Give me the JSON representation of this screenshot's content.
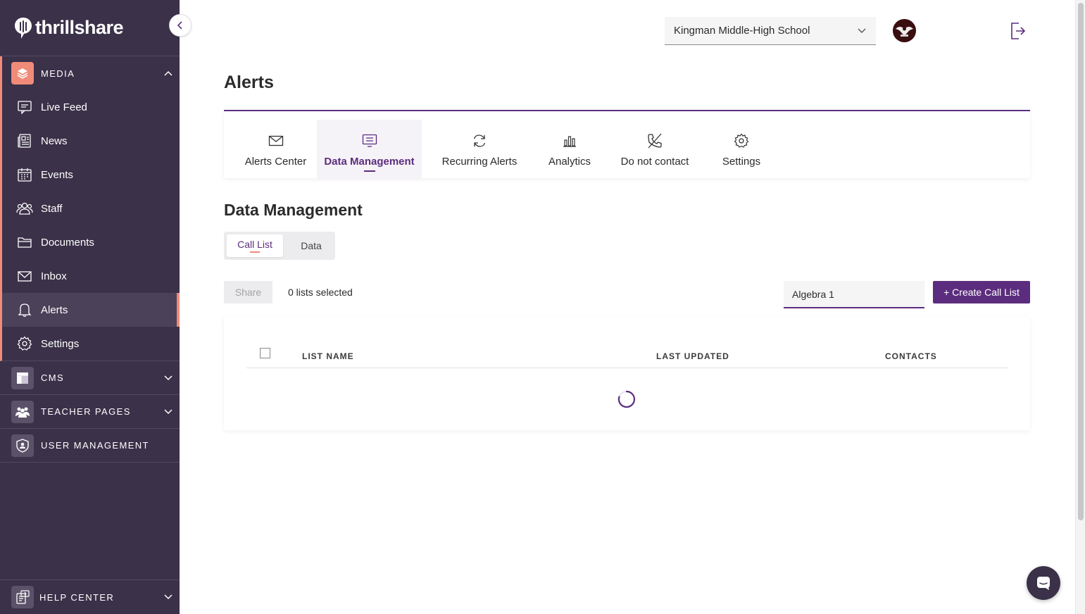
{
  "brand": {
    "name": "thrillshare"
  },
  "sidebar": {
    "media": {
      "label": "MEDIA",
      "items": [
        {
          "label": "Live Feed",
          "icon": "live-feed-icon"
        },
        {
          "label": "News",
          "icon": "news-icon"
        },
        {
          "label": "Events",
          "icon": "calendar-icon"
        },
        {
          "label": "Staff",
          "icon": "staff-icon"
        },
        {
          "label": "Documents",
          "icon": "folder-icon"
        },
        {
          "label": "Inbox",
          "icon": "mail-icon"
        },
        {
          "label": "Alerts",
          "icon": "bell-icon",
          "active": true
        },
        {
          "label": "Settings",
          "icon": "gear-icon"
        }
      ]
    },
    "cms": {
      "label": "CMS"
    },
    "teacher_pages": {
      "label": "TEACHER PAGES"
    },
    "user_management": {
      "label": "USER MANAGEMENT"
    },
    "help_center": {
      "label": "HELP CENTER"
    }
  },
  "header": {
    "school_select": {
      "value": "Kingman Middle-High School"
    }
  },
  "page": {
    "title": "Alerts"
  },
  "tabs": [
    {
      "label": "Alerts Center",
      "icon": "envelope-icon"
    },
    {
      "label": "Data Management",
      "icon": "data-icon",
      "active": true
    },
    {
      "label": "Recurring Alerts",
      "icon": "refresh-icon"
    },
    {
      "label": "Analytics",
      "icon": "bar-chart-icon"
    },
    {
      "label": "Do not contact",
      "icon": "phone-off-icon"
    },
    {
      "label": "Settings",
      "icon": "gear-icon"
    }
  ],
  "section": {
    "title": "Data Management",
    "segments": [
      {
        "label": "Call List",
        "active": true
      },
      {
        "label": "Data"
      }
    ]
  },
  "toolbar": {
    "share_label": "Share",
    "selected_text": "0 lists selected",
    "search_value": "Algebra 1",
    "create_label": "+ Create Call List"
  },
  "table": {
    "columns": [
      "LIST NAME",
      "LAST UPDATED",
      "CONTACTS"
    ],
    "rows": []
  },
  "colors": {
    "sidebar_bg": "#3b3149",
    "accent_purple": "#5c2d7e",
    "accent_coral": "#f08b79"
  }
}
